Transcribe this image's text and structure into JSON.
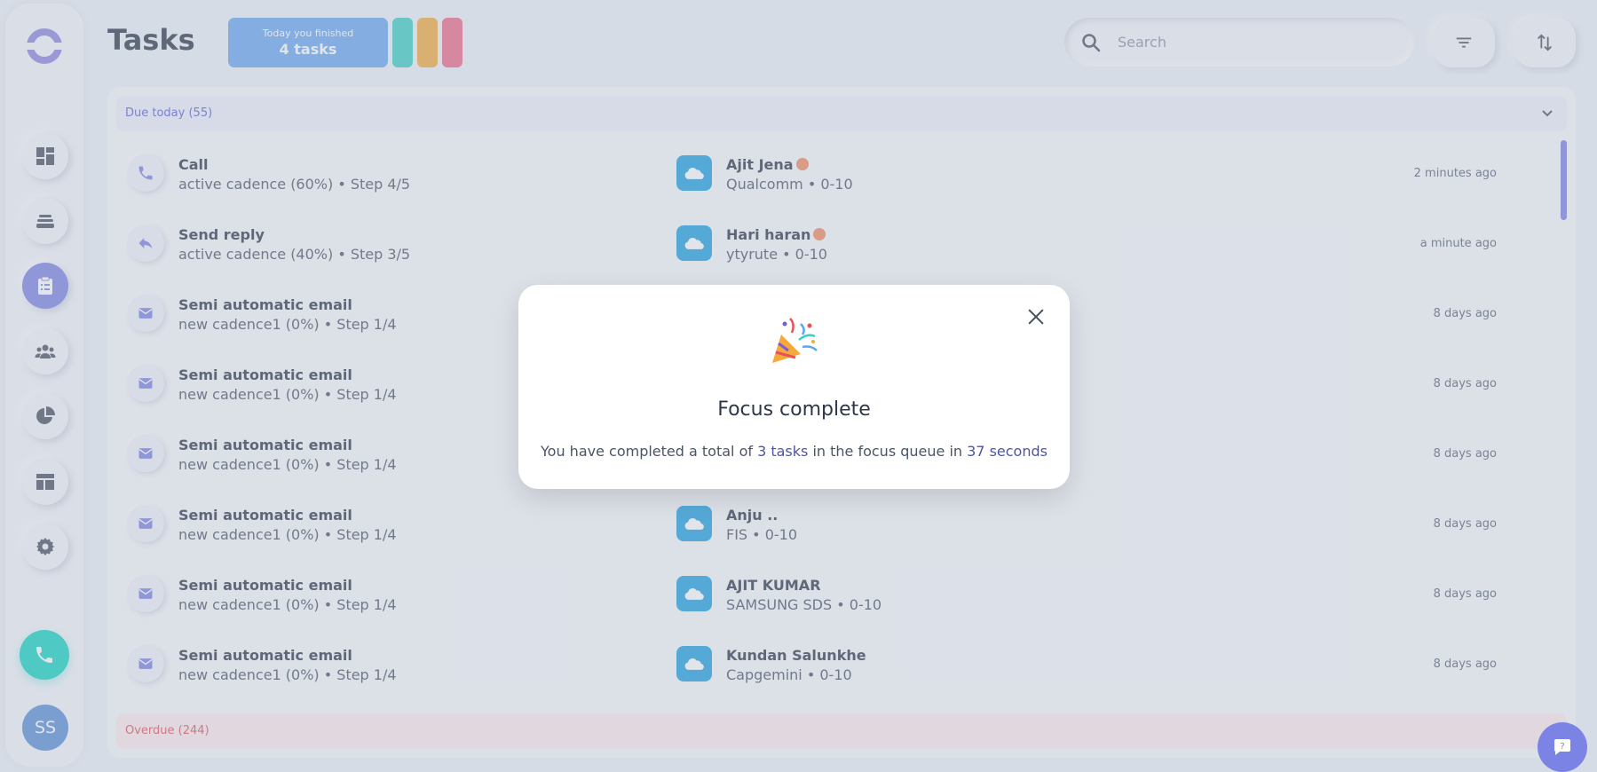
{
  "header": {
    "title": "Tasks",
    "finished_line1": "Today you finished",
    "finished_line2": "4 tasks",
    "search_placeholder": "Search"
  },
  "sidebar": {
    "items": [
      "dashboard",
      "inbox",
      "tasks",
      "contacts",
      "reports",
      "templates",
      "settings"
    ],
    "active": "tasks",
    "avatar_initials": "SS"
  },
  "colors": {
    "accent": "#7b83e4",
    "badge_blue": "#6aa7f0",
    "pill_teal": "#3ccfc4",
    "pill_orange": "#f4ab3e",
    "pill_pink": "#ee6b8a",
    "call_green": "#12d4c2",
    "salesforce_blue": "#1da1e0"
  },
  "sections": {
    "due_today": "Due today (55)",
    "overdue": "Overdue (244)"
  },
  "tasks": [
    {
      "icon": "phone-icon",
      "title": "Call",
      "sub": "active cadence (60%) • Step 4/5",
      "name": "Ajit Jena",
      "hot": true,
      "company": "Qualcomm • 0-10",
      "time": "2 minutes ago"
    },
    {
      "icon": "reply-icon",
      "title": "Send reply",
      "sub": "active cadence (40%) • Step 3/5",
      "name": "Hari haran",
      "hot": true,
      "company": "ytyrute • 0-10",
      "time": "a minute ago"
    },
    {
      "icon": "mail-icon",
      "title": "Semi automatic email",
      "sub": "new cadence1 (0%) • Step 1/4",
      "name": "",
      "hot": false,
      "company": "",
      "time": "8 days ago"
    },
    {
      "icon": "mail-icon",
      "title": "Semi automatic email",
      "sub": "new cadence1 (0%) • Step 1/4",
      "name": "",
      "hot": false,
      "company": "",
      "time": "8 days ago"
    },
    {
      "icon": "mail-icon",
      "title": "Semi automatic email",
      "sub": "new cadence1 (0%) • Step 1/4",
      "name": "",
      "hot": false,
      "company": "",
      "time": "8 days ago"
    },
    {
      "icon": "mail-icon",
      "title": "Semi automatic email",
      "sub": "new cadence1 (0%) • Step 1/4",
      "name": "Anju ..",
      "hot": false,
      "company": "FIS • 0-10",
      "time": "8 days ago"
    },
    {
      "icon": "mail-icon",
      "title": "Semi automatic email",
      "sub": "new cadence1 (0%) • Step 1/4",
      "name": "AJIT KUMAR",
      "hot": false,
      "company": "SAMSUNG SDS • 0-10",
      "time": "8 days ago"
    },
    {
      "icon": "mail-icon",
      "title": "Semi automatic email",
      "sub": "new cadence1 (0%) • Step 1/4",
      "name": "Kundan Salunkhe",
      "hot": false,
      "company": "Capgemini • 0-10",
      "time": "8 days ago"
    }
  ],
  "modal": {
    "title": "Focus complete",
    "text_pre": "You have completed a total of ",
    "tasks_count": "3 tasks",
    "text_mid": " in the focus queue in ",
    "duration": "37 seconds"
  }
}
